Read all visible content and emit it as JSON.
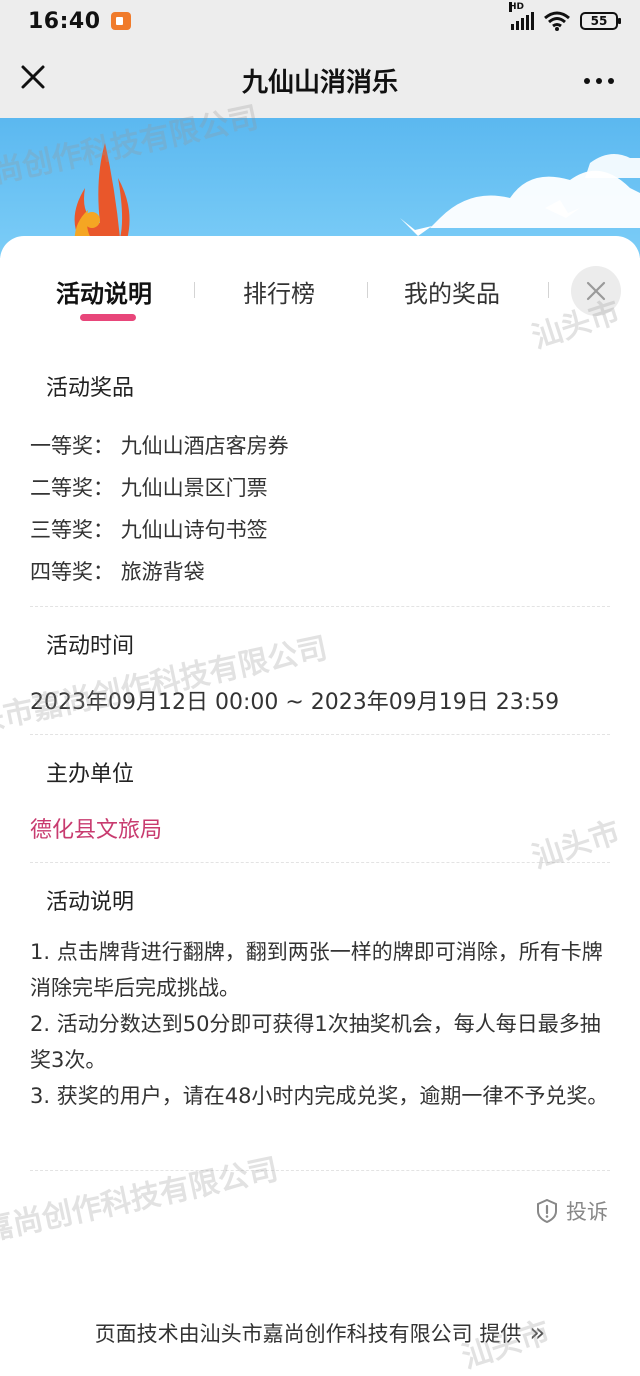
{
  "status": {
    "time": "16:40",
    "battery": "55",
    "network": "HD"
  },
  "nav": {
    "title": "九仙山消消乐"
  },
  "tabs": [
    {
      "label": "活动说明",
      "active": true
    },
    {
      "label": "排行榜",
      "active": false
    },
    {
      "label": "我的奖品",
      "active": false
    }
  ],
  "sections": {
    "prizes": {
      "title": "活动奖品",
      "items": [
        {
          "label": "一等奖：",
          "value": "九仙山酒店客房券"
        },
        {
          "label": "二等奖：",
          "value": "九仙山景区门票"
        },
        {
          "label": "三等奖：",
          "value": "九仙山诗句书签"
        },
        {
          "label": "四等奖：",
          "value": "旅游背袋"
        }
      ]
    },
    "time": {
      "title": "活动时间",
      "value": "2023年09月12日 00:00 ~ 2023年09月19日 23:59"
    },
    "organizer": {
      "title": "主办单位",
      "value": "德化县文旅局"
    },
    "description": {
      "title": "活动说明",
      "lines": [
        "1. 点击牌背进行翻牌，翻到两张一样的牌即可消除，所有卡牌消除完毕后完成挑战。",
        "2. 活动分数达到50分即可获得1次抽奖机会，每人每日最多抽奖3次。",
        "3. 获奖的用户，请在48小时内完成兑奖，逾期一律不予兑奖。"
      ]
    }
  },
  "report": {
    "label": "投诉"
  },
  "footer": {
    "text": "页面技术由汕头市嘉尚创作科技有限公司 提供",
    "arrow": "»"
  },
  "watermark": {
    "main": "汕头市嘉尚创作科技有限公司",
    "fragment1": "尚创作科技有限公司",
    "fragment2": "头市嘉尚创作科技有限公司",
    "fragment3": "嘉尚创作科技有限公司",
    "side": "汕头市"
  },
  "colors": {
    "accent": "#e8467a",
    "organizer": "#c83b6f",
    "sky": "#5bb8f0"
  }
}
